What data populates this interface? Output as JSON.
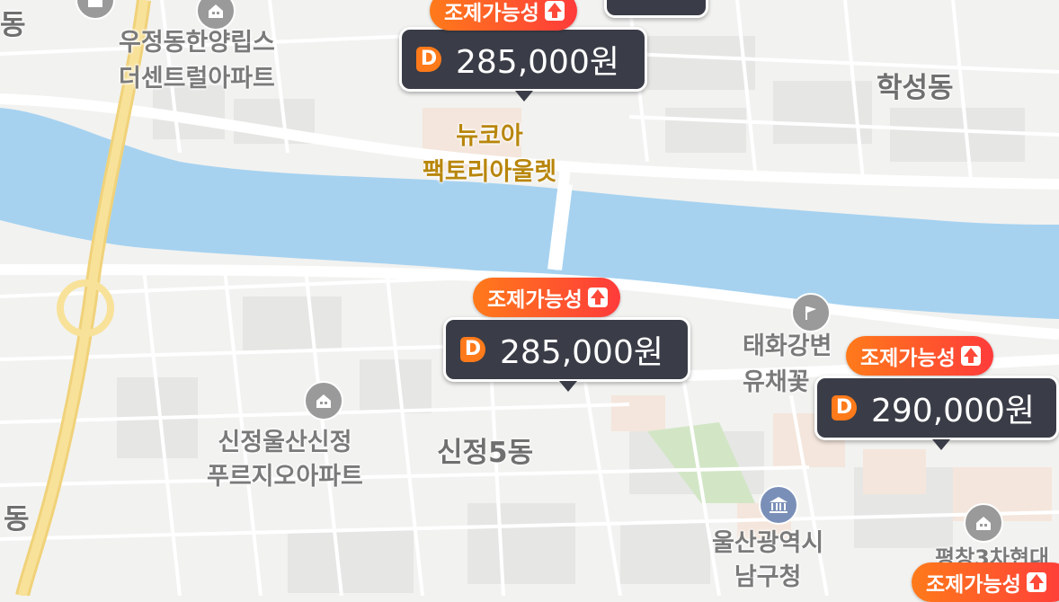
{
  "map": {
    "colors": {
      "land": "#f2f2f0",
      "river": "#a9d3f0",
      "road": "#ffffff",
      "highway": "#f7dd8a",
      "park": "#cfe6c4",
      "block": "#e4e4e2"
    },
    "places": [
      {
        "id": "ujeong",
        "text": "우정동한양립스\n더센트럴아파트"
      },
      {
        "id": "newcore",
        "text": "뉴코아\n팩토리아울렛"
      },
      {
        "id": "haksung",
        "text": "학성동"
      },
      {
        "id": "sinjeong-apt",
        "text": "신정울산신정\n푸르지오아파트"
      },
      {
        "id": "sinjeong5",
        "text": "신정5동"
      },
      {
        "id": "taehwa",
        "text": "태화강변\n유채꽃"
      },
      {
        "id": "namgu",
        "text": "울산광역시\n남구청"
      },
      {
        "id": "edge-left",
        "text": "동"
      },
      {
        "id": "edge-topleft",
        "text": "동"
      },
      {
        "id": "pyeongchang",
        "text": "평창3차현대"
      }
    ],
    "markers": [
      {
        "id": "m-top",
        "badge": "조제가능성",
        "price": "285,000원",
        "icon": "D"
      },
      {
        "id": "m-mid",
        "badge": "조제가능성",
        "price": "285,000원",
        "icon": "D"
      },
      {
        "id": "m-right",
        "badge": "조제가능성",
        "price": "290,000원",
        "icon": "D"
      },
      {
        "id": "m-bottom",
        "badge": "조제가능성",
        "icon": "D"
      }
    ],
    "icons": [
      "apartment-icon",
      "flag-icon",
      "government-icon"
    ]
  }
}
